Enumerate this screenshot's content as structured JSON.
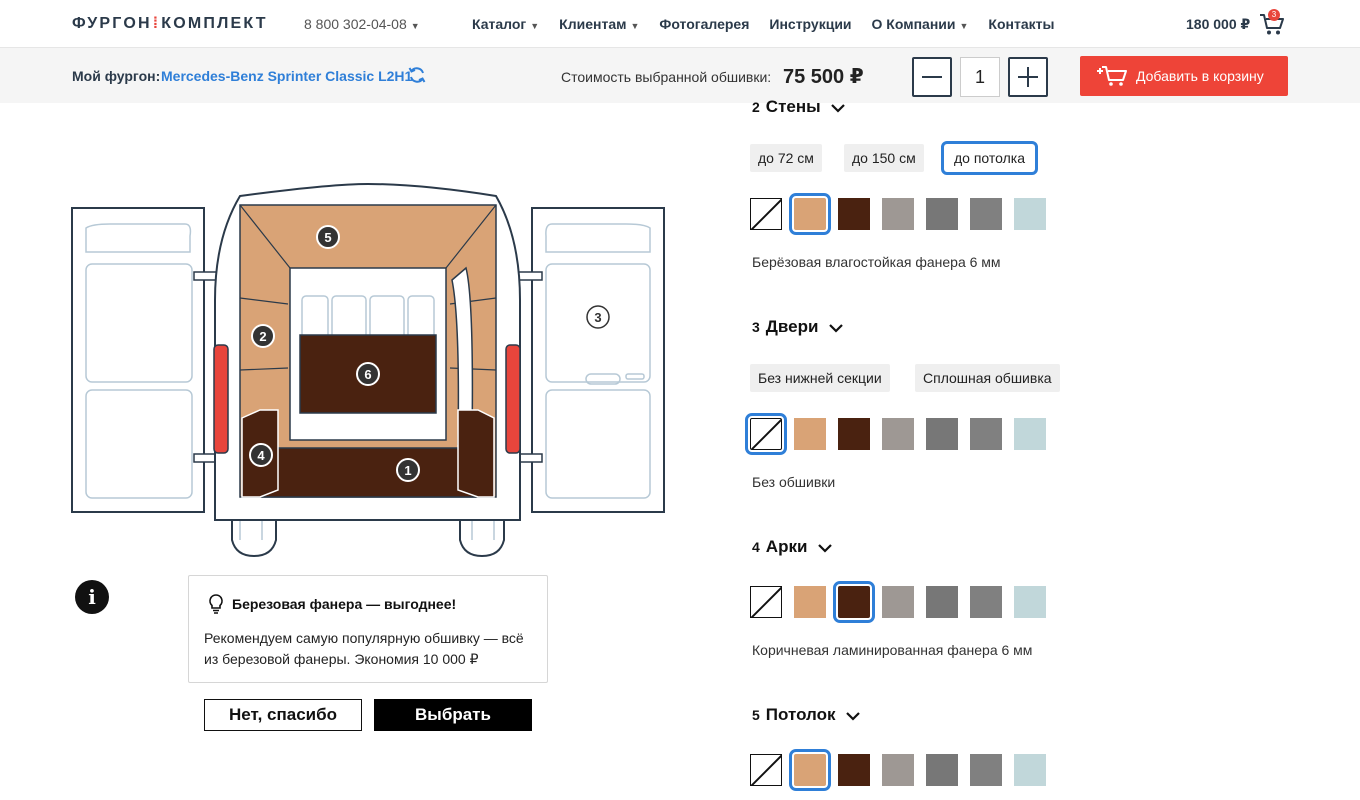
{
  "header": {
    "logo_left": "ФУРГОН",
    "logo_right": "КОМПЛЕКТ",
    "phone": "8 800 302-04-08",
    "nav": [
      {
        "label": "Каталог",
        "dropdown": true
      },
      {
        "label": "Клиентам",
        "dropdown": true
      },
      {
        "label": "Фотогалерея",
        "dropdown": false
      },
      {
        "label": "Инструкции",
        "dropdown": false
      },
      {
        "label": "О Компании",
        "dropdown": true
      },
      {
        "label": "Контакты",
        "dropdown": false
      }
    ],
    "cart_total": "180 000 ₽",
    "cart_count": "3"
  },
  "config_bar": {
    "van_label": "Мой фургон:",
    "van_model": "Mercedes-Benz Sprinter Classic L2H1",
    "cost_label": "Стоимость выбранной обшивки:",
    "cost_value": "75 500 ₽",
    "quantity": "1",
    "add_to_cart": "Добавить в корзину"
  },
  "diagram": {
    "markers": [
      "1",
      "2",
      "3",
      "4",
      "5",
      "6"
    ]
  },
  "tip": {
    "title": "Березовая фанера — выгоднее!",
    "text": "Рекомендуем самую популярную обшивку — всё из березовой фанеры. Экономия 10 000 ₽",
    "decline": "Нет, спасибо",
    "accept": "Выбрать"
  },
  "swatch_colors": [
    "none",
    "#d9a376",
    "#4a2210",
    "#9e9894",
    "#777777",
    "#808080",
    "#c1d7da"
  ],
  "sections": [
    {
      "num": "2",
      "title": "Стены",
      "options": [
        "до 72 см",
        "до 150 см",
        "до потолка"
      ],
      "active_option": 2,
      "selected_swatch": 1,
      "material": "Берёзовая влагостойкая фанера 6 мм"
    },
    {
      "num": "3",
      "title": "Двери",
      "options": [
        "Без нижней секции",
        "Сплошная обшивка"
      ],
      "selected_swatch": 0,
      "material": "Без обшивки"
    },
    {
      "num": "4",
      "title": "Арки",
      "selected_swatch": 2,
      "material": "Коричневая ламинированная фанера 6 мм"
    },
    {
      "num": "5",
      "title": "Потолок",
      "selected_swatch": 1
    }
  ]
}
